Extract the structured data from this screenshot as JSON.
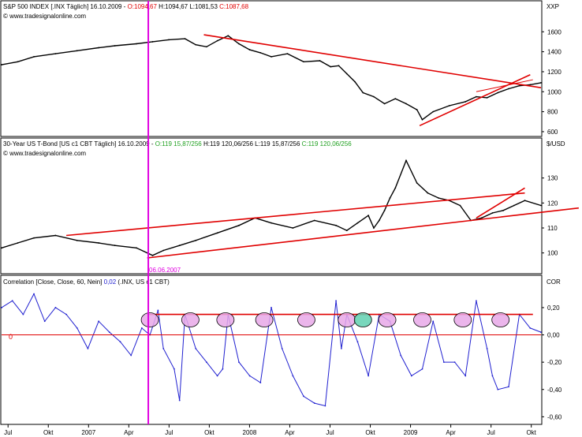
{
  "colors": {
    "price": "#000000",
    "trendline": "#e00000",
    "marker": "#e000e0",
    "correlation": "#2020d0",
    "zero_line": "#e00000",
    "circle_fill": "#e8a8e8",
    "circle_fill_alt": "#60d0b0"
  },
  "x_axis": {
    "ticks": [
      "Jul",
      "Okt",
      "2007",
      "Apr",
      "Jul",
      "Okt",
      "2008",
      "Apr",
      "Jul",
      "Okt",
      "2009",
      "Apr",
      "Jul",
      "Okt"
    ]
  },
  "marker_label": "06.06.2007",
  "chart_data": [
    {
      "type": "line",
      "header": {
        "prefix": "S&P 500 INDEX [.INX  Täglich] 16.10.2009 - ",
        "open": "O:1094,67",
        "rest": " H:1094,67 L:1081,53 ",
        "close": "C:1087,68"
      },
      "source": "© www.tradesignalonline.com",
      "unit": "XXP",
      "ylim": [
        560,
        1760
      ],
      "ytick_labels": [
        "1600",
        "1400",
        "1200",
        "1000",
        "800",
        "600"
      ],
      "ytick_values": [
        1600,
        1400,
        1200,
        1000,
        800,
        600
      ],
      "x_pos": [
        0,
        0.03,
        0.06,
        0.1,
        0.14,
        0.18,
        0.21,
        0.25,
        0.28,
        0.31,
        0.34,
        0.36,
        0.38,
        0.4,
        0.42,
        0.44,
        0.46,
        0.48,
        0.5,
        0.53,
        0.56,
        0.59,
        0.61,
        0.625,
        0.64,
        0.655,
        0.67,
        0.69,
        0.71,
        0.73,
        0.75,
        0.77,
        0.78,
        0.8,
        0.83,
        0.86,
        0.88,
        0.9,
        0.92,
        0.94,
        0.96,
        0.98,
        1.0
      ],
      "values": [
        1270,
        1300,
        1350,
        1380,
        1410,
        1440,
        1460,
        1480,
        1500,
        1520,
        1530,
        1470,
        1450,
        1510,
        1560,
        1480,
        1420,
        1390,
        1350,
        1380,
        1300,
        1310,
        1250,
        1260,
        1180,
        1100,
        990,
        950,
        880,
        930,
        880,
        820,
        720,
        800,
        860,
        900,
        950,
        940,
        990,
        1030,
        1060,
        1070,
        1090
      ]
    },
    {
      "type": "line",
      "header": {
        "prefix": "30-Year US T-Bond [US c1 CBT  Täglich] 16.10.2009 - ",
        "open": "O:119 15,87/256",
        "rest": " H:119 120,06/256 L:119 15,87/256 ",
        "close": "C:119 120,06/256"
      },
      "source": "© www.tradesignalonline.com",
      "unit": "$/USD",
      "ylim": [
        92,
        140
      ],
      "ytick_labels": [
        "130",
        "120",
        "110",
        "100"
      ],
      "ytick_values": [
        130,
        120,
        110,
        100
      ],
      "x_pos": [
        0,
        0.03,
        0.06,
        0.1,
        0.14,
        0.18,
        0.21,
        0.25,
        0.28,
        0.3,
        0.33,
        0.36,
        0.4,
        0.44,
        0.47,
        0.5,
        0.54,
        0.58,
        0.62,
        0.64,
        0.66,
        0.68,
        0.69,
        0.7,
        0.71,
        0.72,
        0.73,
        0.75,
        0.77,
        0.79,
        0.81,
        0.83,
        0.85,
        0.87,
        0.89,
        0.91,
        0.93,
        0.95,
        0.97,
        1.0
      ],
      "values": [
        102,
        104,
        106,
        107,
        105,
        104,
        103,
        102,
        99,
        101,
        103,
        105,
        108,
        111,
        114,
        112,
        110,
        113,
        111,
        109,
        112,
        115,
        110,
        113,
        117,
        122,
        126,
        137,
        128,
        124,
        122,
        121,
        119,
        113,
        114,
        116,
        117,
        119,
        121,
        119
      ]
    },
    {
      "type": "line",
      "header": {
        "prefix": "Correlation [Close, Close, 60, Nein] ",
        "value": "0,02",
        "suffix": " (.INX, US c1 CBT)"
      },
      "unit": "COR",
      "zero_label": "0",
      "ylim": [
        -0.65,
        0.35
      ],
      "ytick_labels": [
        "0,20",
        "0,00",
        "-0,20",
        "-0,40",
        "-0,60"
      ],
      "ytick_values": [
        0.2,
        0.0,
        -0.2,
        -0.4,
        -0.6
      ],
      "threshold": 0.15,
      "x_pos": [
        0,
        0.02,
        0.04,
        0.06,
        0.08,
        0.1,
        0.12,
        0.14,
        0.16,
        0.18,
        0.2,
        0.22,
        0.24,
        0.26,
        0.275,
        0.29,
        0.3,
        0.32,
        0.33,
        0.34,
        0.36,
        0.38,
        0.4,
        0.41,
        0.42,
        0.44,
        0.46,
        0.48,
        0.5,
        0.52,
        0.54,
        0.56,
        0.58,
        0.6,
        0.62,
        0.63,
        0.64,
        0.66,
        0.68,
        0.7,
        0.72,
        0.74,
        0.76,
        0.78,
        0.8,
        0.82,
        0.84,
        0.86,
        0.88,
        0.9,
        0.91,
        0.92,
        0.94,
        0.96,
        0.98,
        1.0
      ],
      "values": [
        0.2,
        0.25,
        0.15,
        0.3,
        0.1,
        0.2,
        0.15,
        0.05,
        -0.1,
        0.1,
        0.02,
        -0.05,
        -0.15,
        0.05,
        0.0,
        0.18,
        -0.1,
        -0.25,
        -0.48,
        0.15,
        -0.1,
        -0.2,
        -0.3,
        -0.25,
        0.15,
        -0.2,
        -0.3,
        -0.35,
        0.2,
        -0.1,
        -0.3,
        -0.45,
        -0.5,
        -0.52,
        0.25,
        -0.1,
        0.15,
        -0.05,
        -0.3,
        0.15,
        0.1,
        -0.15,
        -0.3,
        -0.25,
        0.1,
        -0.2,
        -0.2,
        -0.3,
        0.25,
        -0.1,
        -0.3,
        -0.4,
        -0.38,
        0.15,
        0.05,
        0.02
      ]
    }
  ]
}
